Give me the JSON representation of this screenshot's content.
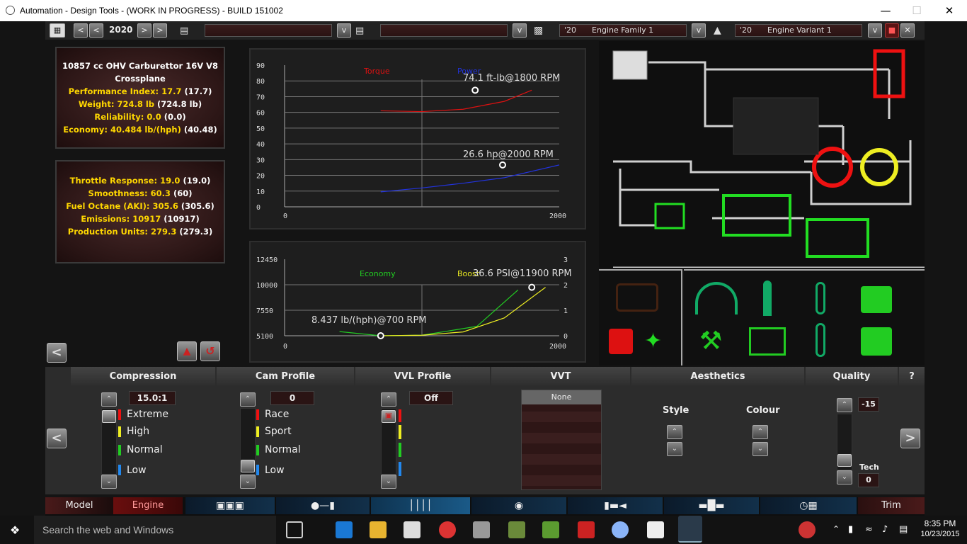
{
  "window": {
    "title": "Automation - Design Tools - (WORK IN PROGRESS) - BUILD 151002"
  },
  "toolbar": {
    "year": "2020",
    "model_field": "",
    "trim_field": "",
    "family_year": "'20",
    "family_name": "Engine Family 1",
    "variant_year": "'20",
    "variant_name": "Engine Variant 1"
  },
  "engine_summary": {
    "title": "10857 cc OHV Carburettor 16V V8 Crossplane",
    "lines": [
      {
        "label": "Performance Index:",
        "value": "17.7",
        "prev": "(17.7)"
      },
      {
        "label": "Weight:",
        "value": "724.8 lb",
        "prev": "(724.8 lb)"
      },
      {
        "label": "Reliability:",
        "value": "0.0",
        "prev": "(0.0)"
      },
      {
        "label": "Economy:",
        "value": "40.484 lb/(hph)",
        "prev": "(40.48)"
      }
    ]
  },
  "engine_stats": [
    {
      "label": "Throttle Response:",
      "value": "19.0",
      "prev": "(19.0)"
    },
    {
      "label": "Smoothness:",
      "value": "60.3",
      "prev": "(60)"
    },
    {
      "label": "Fuel Octane (AKI):",
      "value": "305.6",
      "prev": "(305.6)"
    },
    {
      "label": "Emissions:",
      "value": "10917",
      "prev": "(10917)"
    },
    {
      "label": "Production Units:",
      "value": "279.3",
      "prev": "(279.3)"
    }
  ],
  "chart_data": [
    {
      "type": "line",
      "series": [
        {
          "name": "Torque",
          "color": "#dd1111",
          "x": [
            700,
            1000,
            1300,
            1600,
            1800
          ],
          "y": [
            61,
            60.5,
            62,
            67,
            74.1
          ]
        },
        {
          "name": "Power",
          "color": "#2233dd",
          "x": [
            700,
            1000,
            1300,
            1600,
            2000
          ],
          "y": [
            9.5,
            12,
            15,
            18.5,
            26.6
          ]
        }
      ],
      "xlim": [
        0,
        2000
      ],
      "ylim": [
        0,
        90
      ],
      "yticks": [
        0,
        10,
        20,
        30,
        40,
        50,
        60,
        70,
        80,
        90
      ],
      "xticks": [
        0,
        2000
      ],
      "annotations": [
        "74.1 ft-lb@1800 RPM",
        "26.6 hp@2000 RPM"
      ]
    },
    {
      "type": "line",
      "series": [
        {
          "name": "Economy",
          "color": "#22cc22",
          "x": [
            400,
            700,
            1000,
            1400,
            1700
          ],
          "y": [
            5500,
            5100,
            5150,
            6000,
            9500
          ]
        },
        {
          "name": "Boost",
          "color": "#eeee22",
          "x": [
            700,
            1000,
            1300,
            1600,
            1900
          ],
          "y": [
            0,
            0.02,
            0.15,
            0.7,
            1.9
          ]
        }
      ],
      "xlim": [
        0,
        2000
      ],
      "y1lim": [
        5100,
        12450
      ],
      "y1ticks": [
        5100,
        7550,
        10000,
        12450
      ],
      "y2lim": [
        0,
        3
      ],
      "y2ticks": [
        0,
        1,
        2,
        3
      ],
      "xticks": [
        0,
        2000
      ],
      "annotations": [
        "8.437 lb/(hph)@700 RPM",
        "36.6 PSI@11900 RPM"
      ]
    }
  ],
  "settings": {
    "compression": {
      "header": "Compression",
      "value": "15.0:1",
      "options": [
        "Extreme",
        "High",
        "Normal",
        "Low"
      ]
    },
    "cam": {
      "header": "Cam Profile",
      "value": "0",
      "options": [
        "Race",
        "Sport",
        "Normal",
        "Low"
      ]
    },
    "vvl": {
      "header": "VVL Profile",
      "value": "Off"
    },
    "vvt": {
      "header": "VVT",
      "value": "None"
    },
    "aesthetics": {
      "header": "Aesthetics",
      "style": "Style",
      "colour": "Colour"
    },
    "quality": {
      "header": "Quality",
      "value": "-15",
      "tech_label": "Tech",
      "tech_value": "0",
      "help": "?"
    }
  },
  "nav": {
    "tabs": [
      "Model",
      "Engine",
      "Trim"
    ]
  },
  "taskbar": {
    "search_placeholder": "Search the web and Windows",
    "time": "8:35 PM",
    "date": "10/23/2015"
  },
  "colors": {
    "accent_yellow": "#ffd700",
    "torque": "#dd1111",
    "power": "#2233dd",
    "economy": "#22cc22",
    "boost": "#eeee22",
    "active_green": "#22dd22"
  }
}
